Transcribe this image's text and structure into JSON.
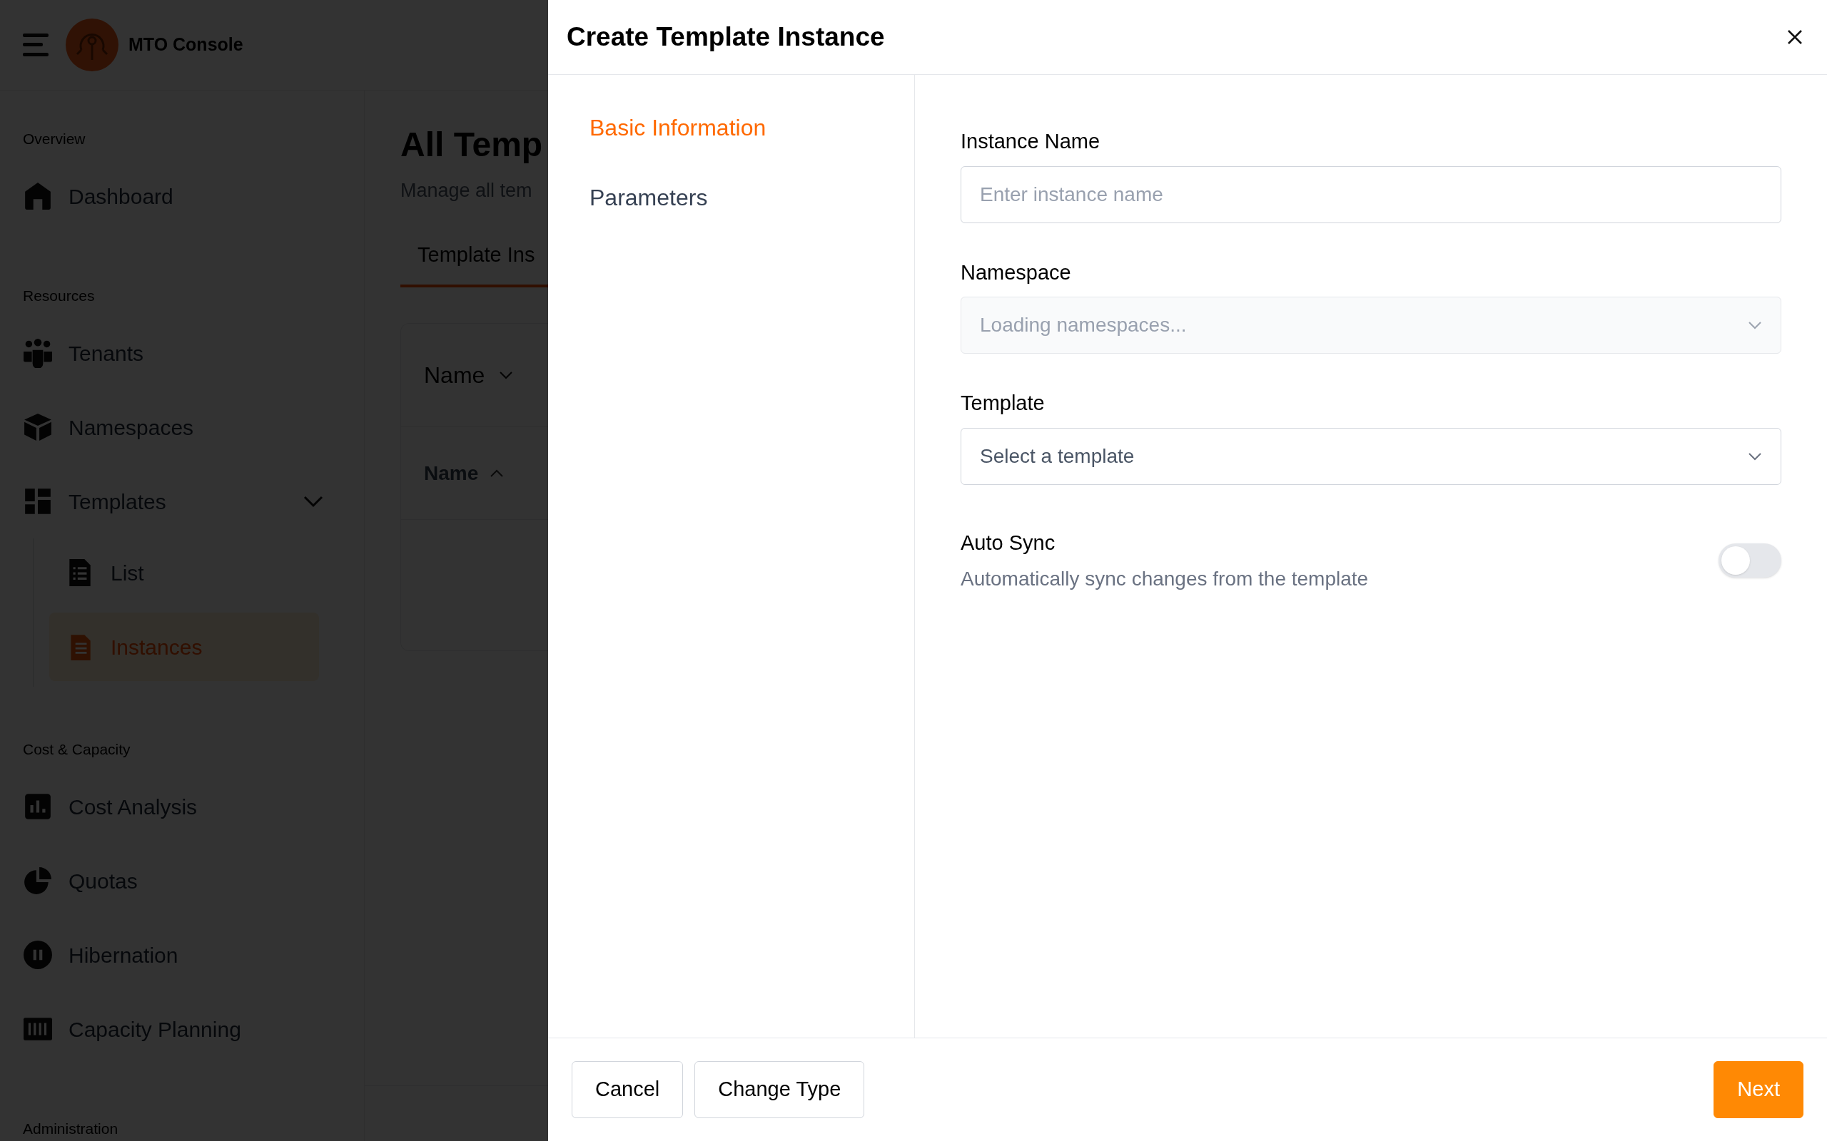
{
  "app": {
    "title": "MTO Console"
  },
  "sidebar": {
    "sections": [
      {
        "label": "Overview",
        "items": [
          {
            "label": "Dashboard",
            "kind": "home",
            "selected": false
          }
        ]
      },
      {
        "label": "Resources",
        "items": [
          {
            "label": "Tenants",
            "kind": "people",
            "selected": false
          },
          {
            "label": "Namespaces",
            "kind": "box",
            "selected": false
          },
          {
            "label": "Templates",
            "kind": "grid",
            "selected": false,
            "expanded": true,
            "children": [
              {
                "label": "List",
                "kind": "list",
                "selected": false
              },
              {
                "label": "Instances",
                "kind": "doc",
                "selected": true
              }
            ]
          }
        ]
      },
      {
        "label": "Cost & Capacity",
        "items": [
          {
            "label": "Cost Analysis",
            "kind": "chart",
            "selected": false
          },
          {
            "label": "Quotas",
            "kind": "pie",
            "selected": false
          },
          {
            "label": "Hibernation",
            "kind": "pause",
            "selected": false
          },
          {
            "label": "Capacity Planning",
            "kind": "bars",
            "selected": false
          }
        ]
      },
      {
        "label": "Administration"
      }
    ]
  },
  "page": {
    "title": "All Temp",
    "subtitle": "Manage all tem",
    "tabs": [
      {
        "label": "Template Ins",
        "selected": true
      }
    ],
    "filter": {
      "label": "Name"
    },
    "columns": [
      {
        "label": "Name",
        "sorted_ascending": true
      }
    ]
  },
  "modal": {
    "title": "Create Template Instance",
    "steps": [
      {
        "label": "Basic Information",
        "selected": true
      },
      {
        "label": "Parameters",
        "selected": false
      }
    ],
    "fields": [
      {
        "kind": "text",
        "label": "Instance Name",
        "placeholder": "Enter instance name",
        "disabled": false
      },
      {
        "kind": "select",
        "label": "Namespace",
        "placeholder": "Loading namespaces...",
        "disabled": true
      },
      {
        "kind": "select",
        "label": "Template",
        "placeholder": "Select a template",
        "disabled": false
      }
    ],
    "auto_sync": {
      "label": "Auto Sync",
      "description": "Automatically sync changes from the template",
      "on": false
    },
    "buttons": [
      {
        "label": "Cancel",
        "kind": "secondary"
      },
      {
        "label": "Change Type",
        "kind": "secondary"
      },
      {
        "label": "Next",
        "kind": "primary"
      }
    ]
  }
}
